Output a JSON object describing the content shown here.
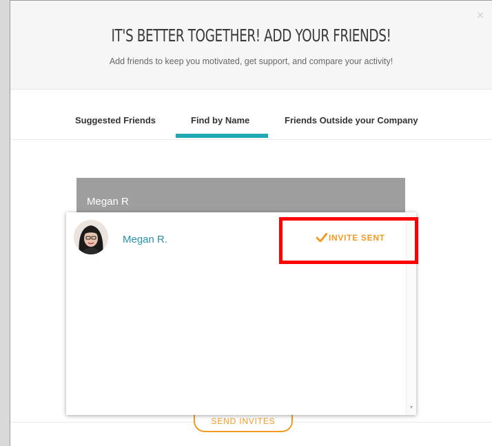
{
  "modal": {
    "title": "IT'S BETTER TOGETHER! ADD YOUR FRIENDS!",
    "subtitle": "Add friends to keep you motivated, get support, and compare your activity!",
    "close_glyph": "×"
  },
  "tabs": {
    "items": [
      {
        "label": "Suggested Friends"
      },
      {
        "label": "Find by Name"
      },
      {
        "label": "Friends Outside your Company"
      }
    ],
    "active": "Find by Name"
  },
  "search": {
    "value": "Megan R"
  },
  "results": [
    {
      "name": "Megan R.",
      "status": "INVITE SENT"
    }
  ],
  "footer": {
    "send_label": "SEND INVITES"
  },
  "colors": {
    "accent_teal": "#1fa9b4",
    "accent_orange": "#f29a21",
    "highlight_red": "#ff0000"
  },
  "icons": [
    "close-icon",
    "check-icon",
    "scroll-up-icon",
    "scroll-down-icon"
  ]
}
